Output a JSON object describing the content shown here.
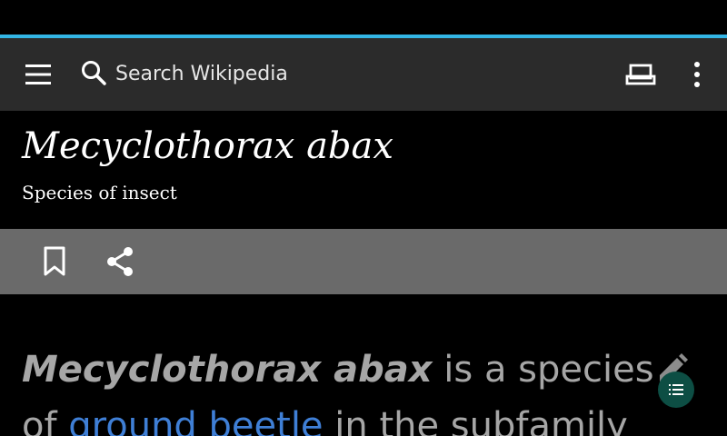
{
  "toolbar": {
    "search_placeholder": "Search Wikipedia",
    "icons": [
      "menu-icon",
      "search-icon",
      "tabs-icon",
      "overflow-menu-icon"
    ]
  },
  "article": {
    "title": "Mecyclothorax abax",
    "description": "Species of insect",
    "lead": {
      "subject": "Mecyclothorax abax",
      "text_1": " is a species of ",
      "link_text": "ground beetle",
      "text_2": " in the subfamily"
    }
  },
  "actions": {
    "icons": [
      "bookmark-icon",
      "share-icon",
      "edit-icon",
      "table-of-contents-icon"
    ]
  },
  "colors": {
    "accent": "#33b5e5",
    "toolbar": "#2b2b2b",
    "action_bar": "#6a6a6a",
    "link": "#3f7fd6",
    "toc_button": "#0d4e44"
  }
}
